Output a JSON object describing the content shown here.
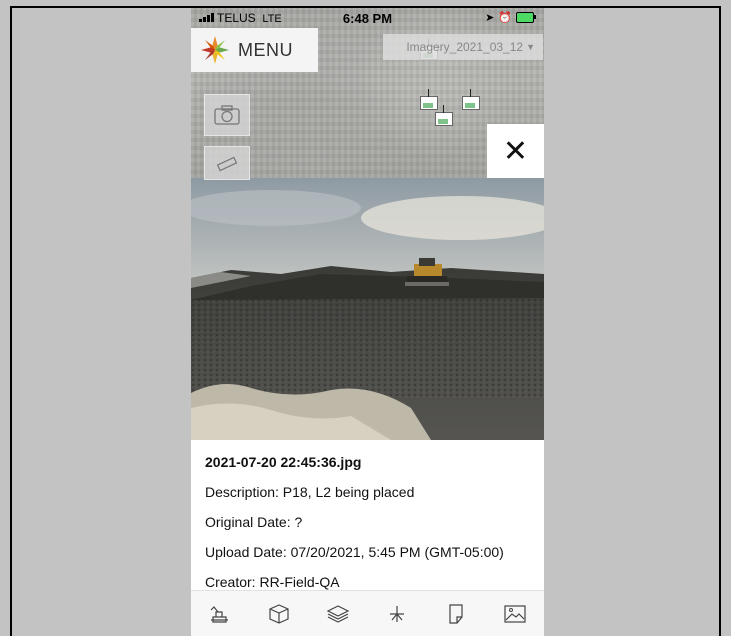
{
  "status_bar": {
    "carrier": "TELUS",
    "network": "LTE",
    "time": "6:48 PM"
  },
  "menu": {
    "label": "MENU"
  },
  "imagery_select": {
    "value": "Imagery_2021_03_12"
  },
  "photo_info": {
    "filename": "2021-07-20 22:45:36.jpg",
    "description": "Description: P18, L2 being placed",
    "original_date": "Original Date: ?",
    "upload_date": "Upload Date: 07/20/2021, 5:45 PM (GMT-05:00)",
    "creator": "Creator: RR-Field-QA"
  },
  "tabs": [
    "excavator-icon",
    "box-icon",
    "layers-icon",
    "survey-point-icon",
    "document-icon",
    "image-icon"
  ],
  "colors": {
    "accent_green": "#7ec38a",
    "logo_orange": "#e88b2e",
    "logo_red": "#c0392b",
    "logo_green": "#6aa84f"
  }
}
